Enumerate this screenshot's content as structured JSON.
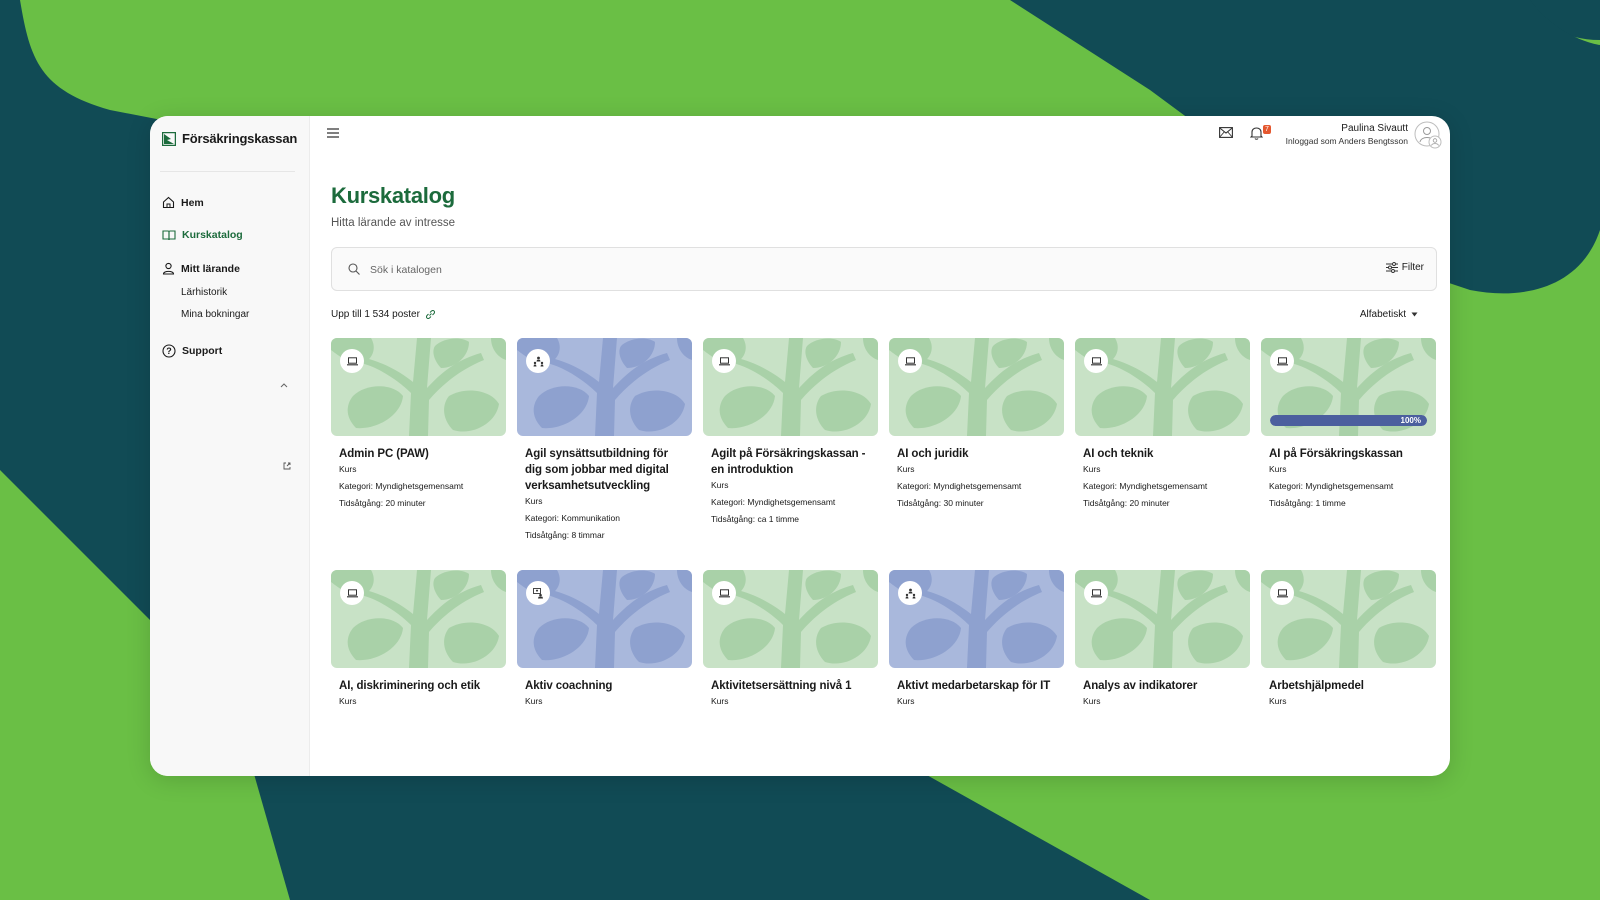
{
  "brand": {
    "name": "Försäkringskassan",
    "accent": "#1c6b3c",
    "bg_green": "#6abf45",
    "bg_dark": "#114b55"
  },
  "sidebar": {
    "items": [
      {
        "label": "Hem",
        "icon": "home-icon"
      },
      {
        "label": "Kurskatalog",
        "icon": "book-icon",
        "active": true
      },
      {
        "label": "Mitt lärande",
        "icon": "user-icon"
      },
      {
        "label": "Support",
        "icon": "help-icon"
      }
    ],
    "sub_items": [
      "Lärhistorik",
      "Mina bokningar"
    ]
  },
  "topbar": {
    "notification_count": "7",
    "user_name": "Paulina Sivautt",
    "user_sub": "Inloggad som Anders Bengtsson"
  },
  "page": {
    "title": "Kurskatalog",
    "subtitle": "Hitta lärande av intresse"
  },
  "search": {
    "placeholder": "Sök i katalogen",
    "filter_label": "Filter"
  },
  "results": {
    "count_label": "Upp till 1 534 poster",
    "sort_label": "Alfabetiskt"
  },
  "cards": [
    {
      "title": "Admin PC (PAW)",
      "type": "Kurs",
      "category": "Kategori: Myndighetsgemensamt",
      "duration": "Tidsåtgång: 20 minuter",
      "theme": "green",
      "icon": "laptop-icon"
    },
    {
      "title": "Agil synsättsutbildning för dig som jobbar med digital verksamhetsutveckling",
      "type": "Kurs",
      "category": "Kategori: Kommunikation",
      "duration": "Tidsåtgång: 8 timmar",
      "theme": "blue",
      "icon": "classroom-icon"
    },
    {
      "title": "Agilt på Försäkringskassan - en introduktion",
      "type": "Kurs",
      "category": "Kategori: Myndighetsgemensamt",
      "duration": "Tidsåtgång: ca 1 timme",
      "theme": "green",
      "icon": "laptop-icon"
    },
    {
      "title": "AI och juridik",
      "type": "Kurs",
      "category": "Kategori: Myndighetsgemensamt",
      "duration": "Tidsåtgång: 30 minuter",
      "theme": "green",
      "icon": "laptop-icon"
    },
    {
      "title": "AI och teknik",
      "type": "Kurs",
      "category": "Kategori: Myndighetsgemensamt",
      "duration": "Tidsåtgång: 20 minuter",
      "theme": "green",
      "icon": "laptop-icon"
    },
    {
      "title": "AI på Försäkringskassan",
      "type": "Kurs",
      "category": "Kategori: Myndighetsgemensamt",
      "duration": "Tidsåtgång: 1 timme",
      "theme": "green",
      "icon": "laptop-icon",
      "progress": 100,
      "progress_label": "100%"
    },
    {
      "title": "AI, diskriminering och etik",
      "type": "Kurs",
      "theme": "green",
      "icon": "laptop-icon"
    },
    {
      "title": "Aktiv coachning",
      "type": "Kurs",
      "theme": "blue",
      "icon": "virtual-classroom-icon"
    },
    {
      "title": "Aktivitetsersättning nivå 1",
      "type": "Kurs",
      "theme": "green",
      "icon": "laptop-icon"
    },
    {
      "title": "Aktivt medarbetarskap för IT",
      "type": "Kurs",
      "theme": "blue",
      "icon": "classroom-icon"
    },
    {
      "title": "Analys av indikatorer",
      "type": "Kurs",
      "theme": "green",
      "icon": "laptop-icon"
    },
    {
      "title": "Arbetshjälpmedel",
      "type": "Kurs",
      "theme": "green",
      "icon": "laptop-icon"
    }
  ]
}
